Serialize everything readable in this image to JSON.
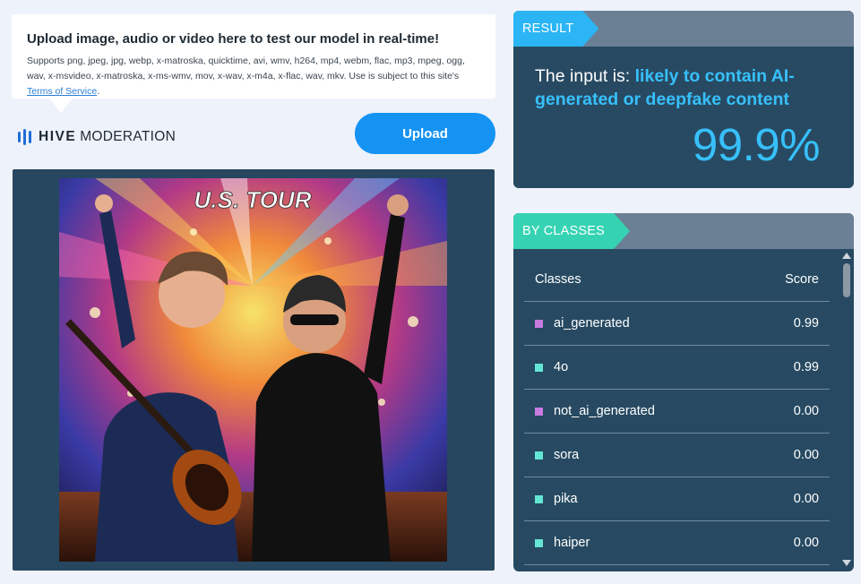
{
  "upload_card": {
    "title": "Upload image, audio or video here to test our model in real-time!",
    "formats_text": "Supports png, jpeg, jpg, webp, x-matroska, quicktime, avi, wmv, h264, mp4, webm, flac, mp3, mpeg, ogg, wav, x-msvideo, x-matroska, x-ms-wmv, mov, x-wav, x-m4a, x-flac, wav, mkv. Use is subject to this site's ",
    "terms_link": "Terms of Service",
    "terms_suffix": "."
  },
  "brand": {
    "bold": "HIVE",
    "rest": "MODERATION",
    "icon": "hive-bars-icon",
    "color": "#1f6fd6"
  },
  "upload_button": {
    "label": "Upload",
    "color": "#1593f3"
  },
  "media": {
    "poster_text": "U.S. TOUR"
  },
  "result": {
    "tag": "RESULT",
    "prefix": "The input is: ",
    "verdict": "likely to contain AI-generated or deepfake content",
    "score": "99.9%",
    "accent": "#37c0fb"
  },
  "classes": {
    "tag": "BY CLASSES",
    "header_class": "Classes",
    "header_score": "Score",
    "rows": [
      {
        "name": "ai_generated",
        "score": "0.99",
        "color": "#c77be0"
      },
      {
        "name": "4o",
        "score": "0.99",
        "color": "#63e6d4"
      },
      {
        "name": "not_ai_generated",
        "score": "0.00",
        "color": "#c77be0"
      },
      {
        "name": "sora",
        "score": "0.00",
        "color": "#63e6d4"
      },
      {
        "name": "pika",
        "score": "0.00",
        "color": "#63e6d4"
      },
      {
        "name": "haiper",
        "score": "0.00",
        "color": "#63e6d4"
      }
    ]
  }
}
